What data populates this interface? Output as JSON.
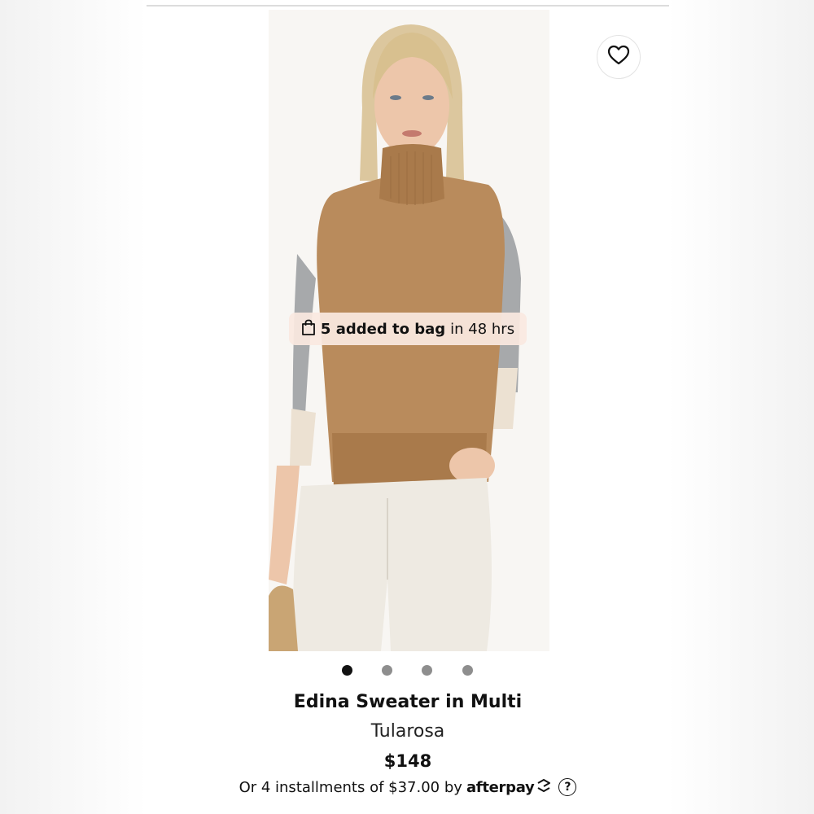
{
  "badge": {
    "icon": "shopping-bag-icon",
    "strong_text": "5 added to bag",
    "rest_text": "in 48 hrs"
  },
  "favorite": {
    "icon": "heart-icon"
  },
  "carousel": {
    "count": 4,
    "active_index": 0
  },
  "product": {
    "title": "Edina Sweater in Multi",
    "brand": "Tularosa",
    "price": "$148"
  },
  "installments": {
    "text": "Or 4 installments of $37.00 by",
    "provider": "afterpay",
    "provider_icon": "afterpay-arrows-icon",
    "help_icon": "question-mark-icon",
    "help_label": "?"
  },
  "colors": {
    "sweater": "#b98b5c",
    "sleeve_gray": "#a7a9ab",
    "cuff_cream": "#ece1d2",
    "pants": "#eeeae2",
    "dot_active": "#111111",
    "dot_inactive": "#8e8e8e"
  }
}
